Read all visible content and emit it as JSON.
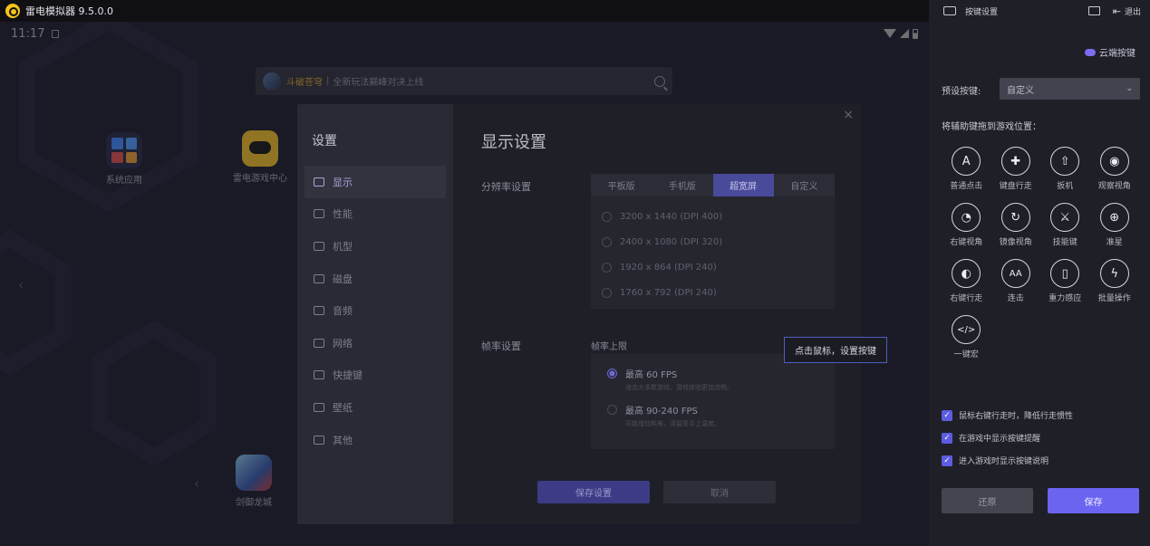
{
  "titlebar": {
    "app_name": "雷电模拟器 9.5.0.0"
  },
  "android": {
    "time": "11:17",
    "search": {
      "highlight": "斗破苍穹",
      "sep": "|",
      "text": "全新玩法巅峰对决上线"
    },
    "apps": [
      {
        "label": "系统应用"
      },
      {
        "label": "雷电游戏中心"
      },
      {
        "label": "剑御龙城"
      }
    ]
  },
  "settings": {
    "sidebar_title": "设置",
    "sidebar_items": [
      "显示",
      "性能",
      "机型",
      "磁盘",
      "音频",
      "网络",
      "快捷键",
      "壁纸",
      "其他"
    ],
    "main_title": "显示设置",
    "resolution_label": "分辨率设置",
    "resolution_tabs": [
      "平板版",
      "手机版",
      "超宽屏",
      "自定义"
    ],
    "resolution_active": "超宽屏",
    "resolution_options": [
      "3200 x 1440 (DPI 400)",
      "2400 x 1080 (DPI 320)",
      "1920 x 864 (DPI 240)",
      "1760 x 792 (DPI 240)"
    ],
    "fps_section_label": "帧率设置",
    "fps_sub_label": "帧率上限",
    "fps_options": [
      {
        "label": "最高 60 FPS",
        "desc": "适合大多数游戏，游戏体验更加流畅。",
        "selected": true
      },
      {
        "label": "最高 90-240 FPS",
        "desc": "可能增加耗电，请留意手上温度。",
        "selected": false
      }
    ],
    "save_label": "保存设置",
    "cancel_label": "取消"
  },
  "tooltip": "点击鼠标，设置按键",
  "keymap_panel": {
    "header_title": "按键设置",
    "exit_label": "退出",
    "cloud_label": "云端按键",
    "preset_label": "预设按键:",
    "preset_value": "自定义",
    "drag_hint": "将辅助键拖到游戏位置：",
    "keys": [
      {
        "label": "普通点击",
        "glyph": "A",
        "icon": "tap-icon"
      },
      {
        "label": "键盘行走",
        "glyph": "✚",
        "icon": "dpad-icon"
      },
      {
        "label": "扳机",
        "glyph": "⇧",
        "icon": "trigger-icon"
      },
      {
        "label": "观察视角",
        "glyph": "◉",
        "icon": "eye-icon"
      },
      {
        "label": "右键视角",
        "glyph": "◔",
        "icon": "right-view-icon"
      },
      {
        "label": "镜像视角",
        "glyph": "↻",
        "icon": "mirror-view-icon"
      },
      {
        "label": "技能键",
        "glyph": "⚔",
        "icon": "skill-icon"
      },
      {
        "label": "准星",
        "glyph": "⊕",
        "icon": "crosshair-icon"
      },
      {
        "label": "右键行走",
        "glyph": "◐",
        "icon": "mouse-icon"
      },
      {
        "label": "连击",
        "glyph": "AA",
        "icon": "combo-icon"
      },
      {
        "label": "重力感应",
        "glyph": "▯",
        "icon": "gravity-icon"
      },
      {
        "label": "批量操作",
        "glyph": "ϟ",
        "icon": "lightning-icon"
      },
      {
        "label": "一键宏",
        "glyph": "</>",
        "icon": "macro-icon"
      }
    ],
    "checks": [
      "鼠标右键行走时，降低行走惯性",
      "在游戏中显示按键提醒",
      "进入游戏时显示按键说明"
    ],
    "restore_label": "还原",
    "save_label": "保存"
  }
}
